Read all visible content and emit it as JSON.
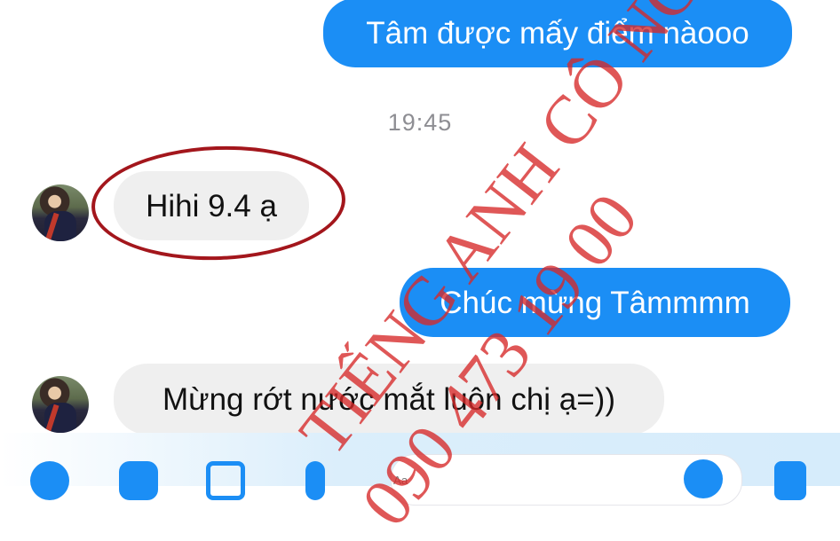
{
  "conversation": {
    "messages": [
      {
        "id": "m1",
        "direction": "outgoing",
        "text": "Tâm được mấy điểm nàooo"
      },
      {
        "id": "m2",
        "direction": "incoming",
        "text": "Hihi 9.4 ạ",
        "highlighted": true
      },
      {
        "id": "m3",
        "direction": "outgoing",
        "text": "Chúc mừng Tâmmmm"
      },
      {
        "id": "m4",
        "direction": "incoming",
        "text": "Mừng rớt nước mắt luôn chị ạ=))"
      }
    ],
    "timestamp": "19:45"
  },
  "watermark": {
    "line1": "TIẾNG ANH CÔ NGA",
    "line2": "090 473 19 00"
  },
  "composer": {
    "icons": [
      "plus-icon",
      "camera-icon",
      "gallery-icon",
      "mic-icon",
      "emoji-icon",
      "thumbs-up-icon"
    ],
    "input_placeholder": "Aa"
  },
  "colors": {
    "outgoing_bubble": "#1b8ef5",
    "incoming_bubble": "#efefef",
    "highlight_ring": "#a3161c",
    "watermark": "#d62828"
  }
}
